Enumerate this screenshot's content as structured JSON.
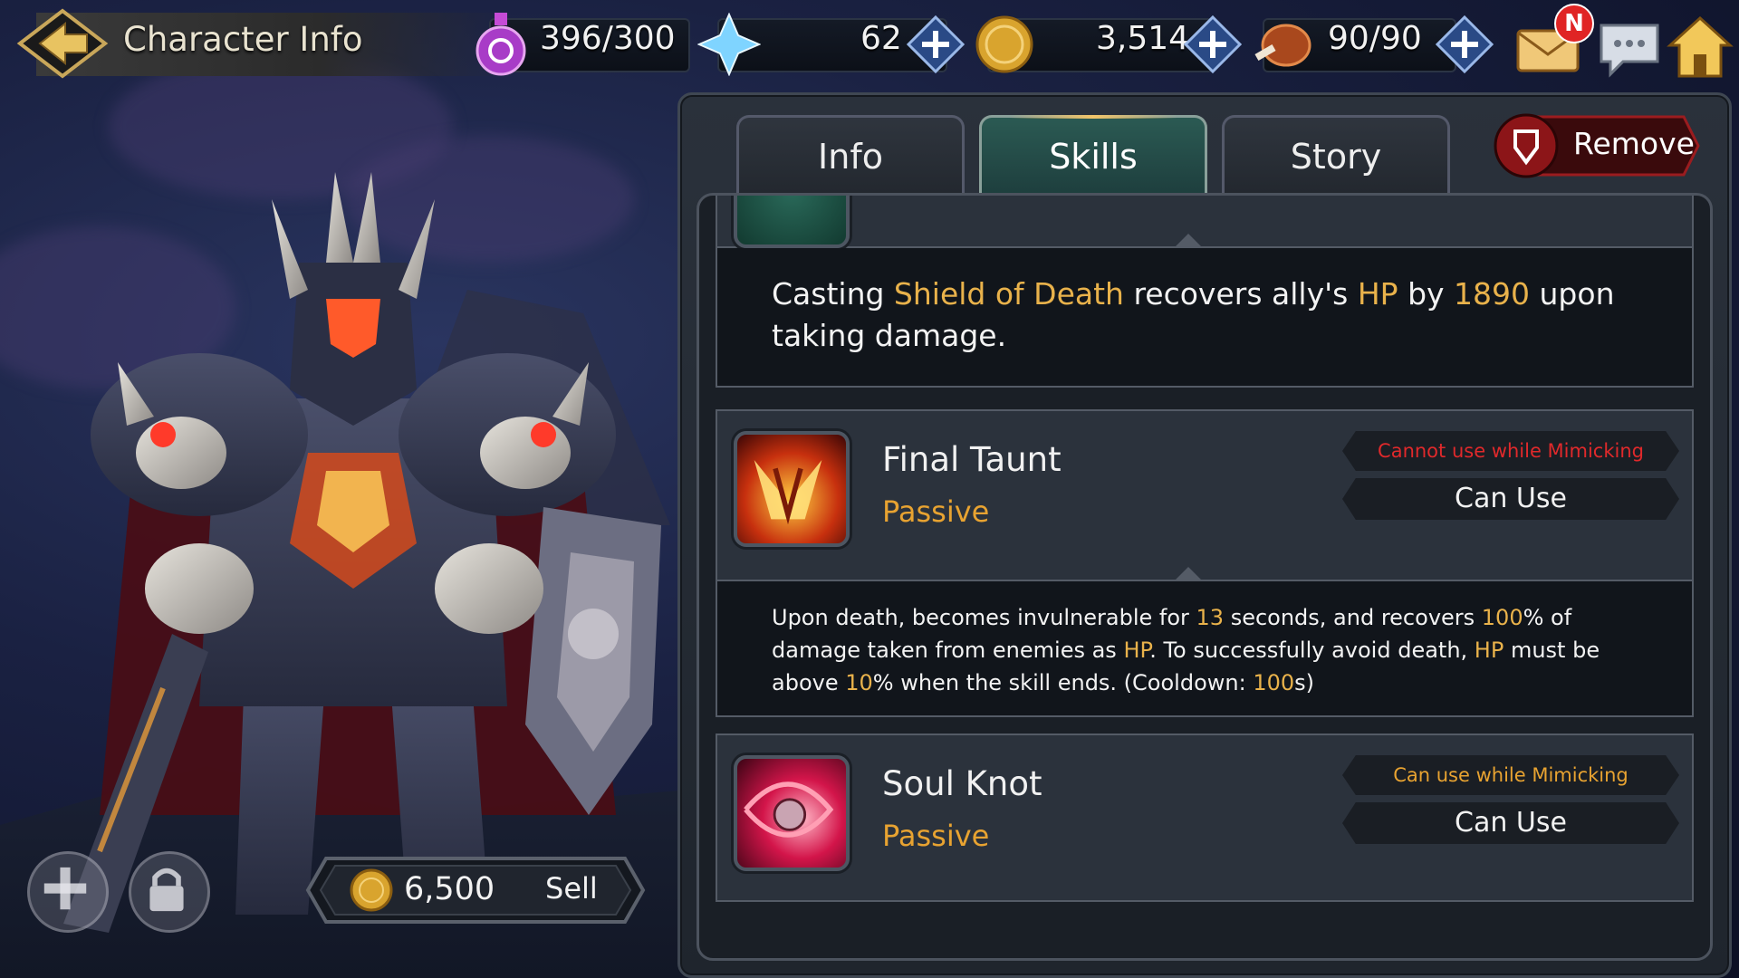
{
  "header": {
    "title": "Character Info",
    "stamina": "396/300",
    "gems": "62",
    "gold": "3,514",
    "food": "90/90",
    "mail_badge": "N"
  },
  "tabs": [
    {
      "label": "Info",
      "active": false
    },
    {
      "label": "Skills",
      "active": true
    },
    {
      "label": "Story",
      "active": false
    }
  ],
  "remove_label": "Remove",
  "skill_top_desc": {
    "p1": "Casting ",
    "skill": "Shield of Death",
    "p2": " recovers ally's ",
    "hp": "HP",
    "p3": " by ",
    "amount": "1890",
    "p4": " upon taking damage."
  },
  "skills": [
    {
      "name": "Final Taunt",
      "type": "Passive",
      "mimic": "Cannot use while Mimicking",
      "usable": "Can Use",
      "desc": {
        "t1": "Upon death, becomes invulnerable for ",
        "sec": "13",
        "t2": " seconds, and recovers ",
        "pct": "100",
        "t3": "% of damage taken from enemies as ",
        "hp1": "HP",
        "t4": ". To successfully avoid death, ",
        "hp2": "HP",
        "t5": " must be above ",
        "min": "10",
        "t6": "% when the skill ends. (Cooldown: ",
        "cd": "100",
        "t7": "s)"
      }
    },
    {
      "name": "Soul Knot",
      "type": "Passive",
      "mimic": "Can use while Mimicking",
      "usable": "Can Use"
    }
  ],
  "sell": {
    "price": "6,500",
    "label": "Sell"
  },
  "colors": {
    "highlight": "#f1a33a",
    "hp_blue": "#4fb3ff",
    "mimic_red": "#e0292b",
    "mimic_gold": "#e8a331"
  },
  "icons": [
    "back-arrow-icon",
    "stamina-potion-icon",
    "gem-icon",
    "gold-coin-icon",
    "food-meat-icon",
    "mail-icon",
    "chat-icon",
    "home-icon",
    "remove-icon",
    "plus-icon",
    "lock-icon"
  ]
}
